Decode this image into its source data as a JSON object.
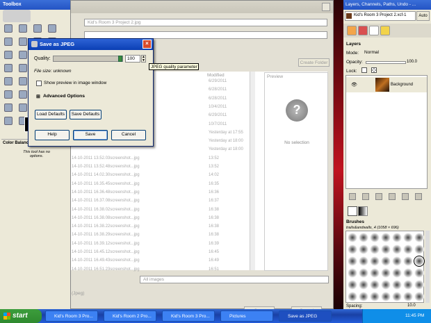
{
  "toolbox": {
    "title": "Toolbox",
    "options_title": "Color Balance",
    "options_note": "This tool has no options."
  },
  "file_dialog": {
    "name_value": "Kid's Room 3 Project 2.jpg",
    "create_folder": "Create Folder",
    "modified_header": "Modified",
    "preview_header": "Preview",
    "no_selection": "No selection",
    "files": [
      {
        "name": "",
        "modified": "6/29/2011"
      },
      {
        "name": "",
        "modified": "6/28/2011"
      },
      {
        "name": "",
        "modified": "6/28/2011"
      },
      {
        "name": "",
        "modified": "10/4/2011"
      },
      {
        "name": "",
        "modified": "6/29/2011"
      },
      {
        "name": "",
        "modified": "10/7/2011"
      },
      {
        "name": "",
        "modified": "Yesterday at 17:55"
      },
      {
        "name": "",
        "modified": "Yesterday at 18:00"
      },
      {
        "name": "",
        "modified": "Yesterday at 18:00"
      },
      {
        "name": "14-10-2011 13.52.03screenshot...jpg",
        "modified": "13:52"
      },
      {
        "name": "14-10-2011 13.52.48screenshot...jpg",
        "modified": "13:52"
      },
      {
        "name": "14-10-2011 14.02.30screenshot...jpg",
        "modified": "14:02"
      },
      {
        "name": "14-10-2011 16.35.45screenshot...jpg",
        "modified": "16:35"
      },
      {
        "name": "14-10-2011 16.36.48screenshot...jpg",
        "modified": "16:36"
      },
      {
        "name": "14-10-2011 16.37.08screenshot...jpg",
        "modified": "16:37"
      },
      {
        "name": "14-10-2011 16.38.02screenshot...jpg",
        "modified": "16:38"
      },
      {
        "name": "14-10-2011 16.38.08screenshot...jpg",
        "modified": "16:38"
      },
      {
        "name": "14-10-2011 16.38.22screenshot...jpg",
        "modified": "16:38"
      },
      {
        "name": "14-10-2011 16.38.29screenshot...jpg",
        "modified": "16:38"
      },
      {
        "name": "14-10-2011 16.39.12screenshot...jpg",
        "modified": "16:39"
      },
      {
        "name": "14-10-2011 16.45.12screenshot...jpg",
        "modified": "16:45"
      },
      {
        "name": "14-10-2011 16.49.43screenshot...jpg",
        "modified": "16:49"
      },
      {
        "name": "14-10-2011 16.51.23screenshot...jpg",
        "modified": "16:51"
      }
    ],
    "filter": "All images",
    "file_type_label": "(Jpeg)",
    "save_label": "Save",
    "cancel_label": "Cancel"
  },
  "layers": {
    "title": "Layers, Channels, Paths, Undo - ...",
    "image_name": "Kid's Room 3 Project 2.xcf-1",
    "auto_label": "Auto",
    "section": "Layers",
    "mode_label": "Mode:",
    "mode_value": "Normal",
    "opacity_label": "Opacity:",
    "opacity_value": "100.0",
    "lock_label": "Lock:",
    "layer_name": "Background",
    "brushes_label": "Brushes",
    "brush_name": "trails&andwalls_4 (1058 × 696)",
    "spacing_label": "Spacing:",
    "spacing_value": "10.0"
  },
  "jpeg_dialog": {
    "title": "Save as JPEG",
    "quality_label": "Quality:",
    "quality_value": "100",
    "quality_fraction": 1.0,
    "file_size": "File size: unknown",
    "show_preview": "Show preview in image window",
    "advanced_options": "Advanced Options",
    "load_defaults": "Load Defaults",
    "save_defaults": "Save Defaults",
    "help": "Help",
    "save": "Save",
    "cancel": "Cancel",
    "tooltip": "JPEG quality parameter"
  },
  "taskbar": {
    "start": "start",
    "buttons": [
      "Kid's Room 3 Pro...",
      "Kid's Room 2 Pro...",
      "Kid's Room 3 Pro...",
      "Pictures",
      "Save as JPEG"
    ],
    "clock": "11:45 PM"
  },
  "colors": {
    "xp_blue": "#2454c4",
    "start_green": "#3c9d3c",
    "dialog_bg": "#ece9d8",
    "close_red": "#d74a2b"
  }
}
